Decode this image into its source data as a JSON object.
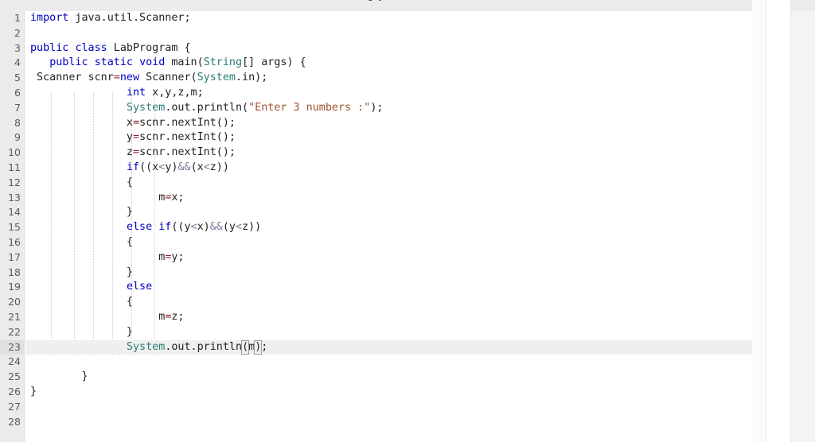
{
  "window": {
    "clipped_toolbar_text": "g y",
    "language": "Java"
  },
  "editor": {
    "highlighted_line": 23,
    "colors": {
      "keyword": "#0000c0",
      "type": "#2b7a78",
      "string": "#a0522d",
      "operator": "#7a7a9a",
      "assign": "#8b2020",
      "plain": "#222222",
      "gutter_bg": "#ebebeb",
      "line_highlight": "#efefef",
      "editor_bg": "#ffffff"
    },
    "line_numbers": [
      1,
      2,
      3,
      4,
      5,
      6,
      7,
      8,
      9,
      10,
      11,
      12,
      13,
      14,
      15,
      16,
      17,
      18,
      19,
      20,
      21,
      22,
      23,
      24,
      25,
      26,
      27,
      28
    ],
    "lines": [
      {
        "n": 1,
        "text": "import java.util.Scanner;"
      },
      {
        "n": 2,
        "text": ""
      },
      {
        "n": 3,
        "text": "public class LabProgram {"
      },
      {
        "n": 4,
        "text": "   public static void main(String[] args) {"
      },
      {
        "n": 5,
        "text": " Scanner scnr=new Scanner(System.in);"
      },
      {
        "n": 6,
        "text": "               int x,y,z,m;"
      },
      {
        "n": 7,
        "text": "               System.out.println(\"Enter 3 numbers :\");"
      },
      {
        "n": 8,
        "text": "               x=scnr.nextInt();"
      },
      {
        "n": 9,
        "text": "               y=scnr.nextInt();"
      },
      {
        "n": 10,
        "text": "               z=scnr.nextInt();"
      },
      {
        "n": 11,
        "text": "               if((x<y)&&(x<z))"
      },
      {
        "n": 12,
        "text": "               {"
      },
      {
        "n": 13,
        "text": "                    m=x;"
      },
      {
        "n": 14,
        "text": "               }"
      },
      {
        "n": 15,
        "text": "               else if((y<x)&&(y<z))"
      },
      {
        "n": 16,
        "text": "               {"
      },
      {
        "n": 17,
        "text": "                    m=y;"
      },
      {
        "n": 18,
        "text": "               }"
      },
      {
        "n": 19,
        "text": "               else"
      },
      {
        "n": 20,
        "text": "               {"
      },
      {
        "n": 21,
        "text": "                    m=z;"
      },
      {
        "n": 22,
        "text": "               }"
      },
      {
        "n": 23,
        "text": "               System.out.println(m);"
      },
      {
        "n": 24,
        "text": ""
      },
      {
        "n": 25,
        "text": "        }"
      },
      {
        "n": 26,
        "text": "}"
      },
      {
        "n": 27,
        "text": ""
      },
      {
        "n": 28,
        "text": ""
      }
    ]
  }
}
